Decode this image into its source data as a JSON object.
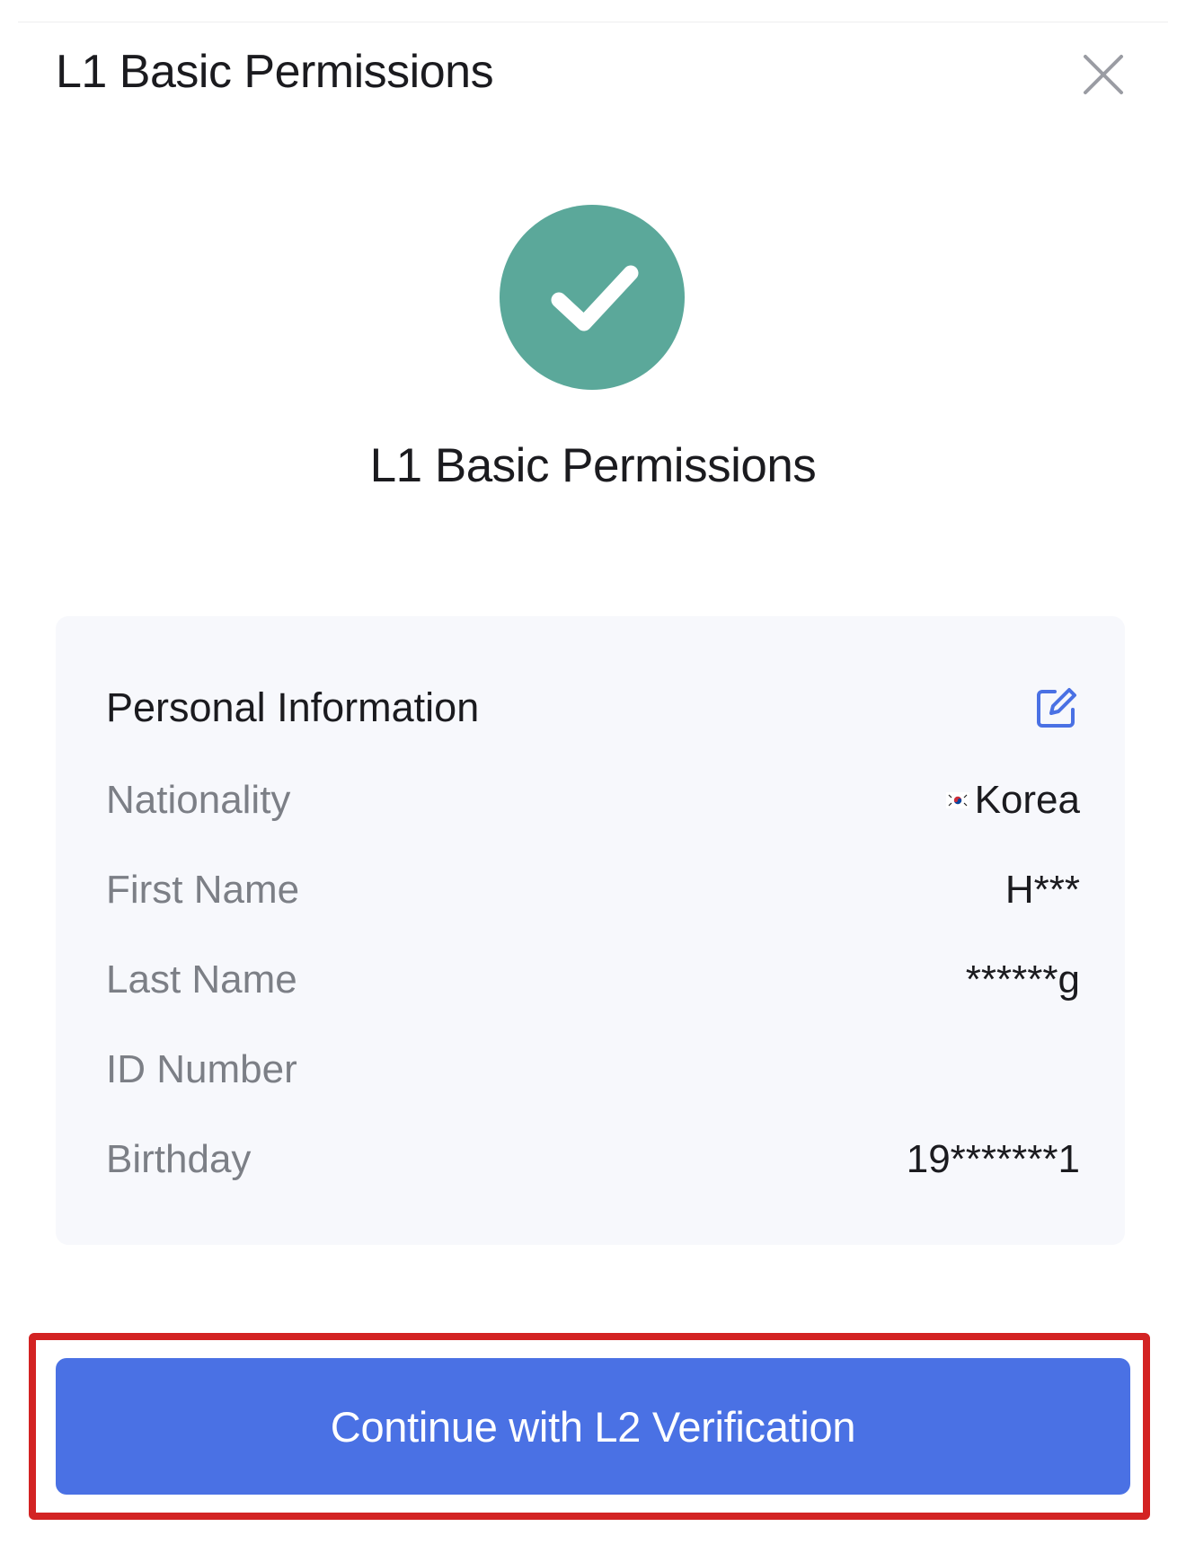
{
  "modal": {
    "title": "L1 Basic Permissions",
    "close_icon": "close-icon"
  },
  "status": {
    "icon": "check-icon",
    "color": "#5ba89a",
    "level_title": "L1 Basic Permissions"
  },
  "personal_info": {
    "title": "Personal Information",
    "edit_icon": "edit-icon",
    "accent": "#4a71e4",
    "rows": [
      {
        "label": "Nationality",
        "value": "Korea",
        "flag_icon": "korea-flag-icon"
      },
      {
        "label": "First Name",
        "value": "H***"
      },
      {
        "label": "Last Name",
        "value": "******g"
      },
      {
        "label": "ID Number",
        "value": ""
      },
      {
        "label": "Birthday",
        "value": "19*******1"
      }
    ]
  },
  "cta": {
    "label": "Continue with L2 Verification",
    "button_color": "#4a71e4",
    "highlight_color": "#d32323"
  }
}
